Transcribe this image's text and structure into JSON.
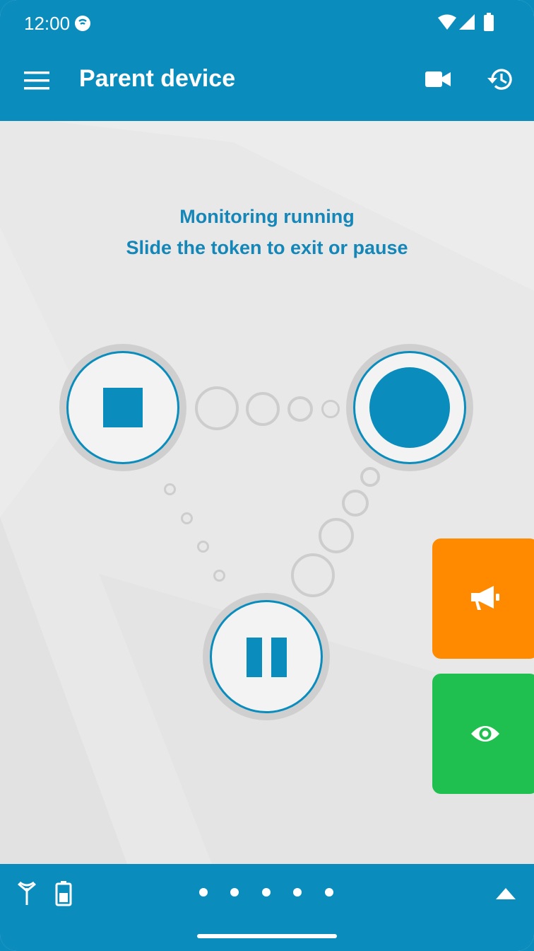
{
  "status_bar": {
    "time": "12:00"
  },
  "app_bar": {
    "title": "Parent device",
    "menu_icon": "hamburger-menu-icon",
    "camera_icon": "video-camera-icon",
    "history_icon": "history-icon"
  },
  "message": {
    "line1": "Monitoring running",
    "line2": "Slide the token to exit or pause"
  },
  "tokens": {
    "stop": "stop-icon",
    "record": "record-token",
    "pause": "pause-icon"
  },
  "side_buttons": {
    "announce": {
      "icon": "megaphone-icon",
      "color": "#ff8a00"
    },
    "view": {
      "icon": "eye-icon",
      "color": "#1fc04f"
    }
  },
  "bottom_bar": {
    "signal_icon": "antenna-icon",
    "battery_icon": "battery-icon",
    "page_dots": 5,
    "expand_icon": "triangle-up-icon"
  },
  "colors": {
    "primary": "#0a8cbd",
    "background": "#e8e8e8"
  }
}
